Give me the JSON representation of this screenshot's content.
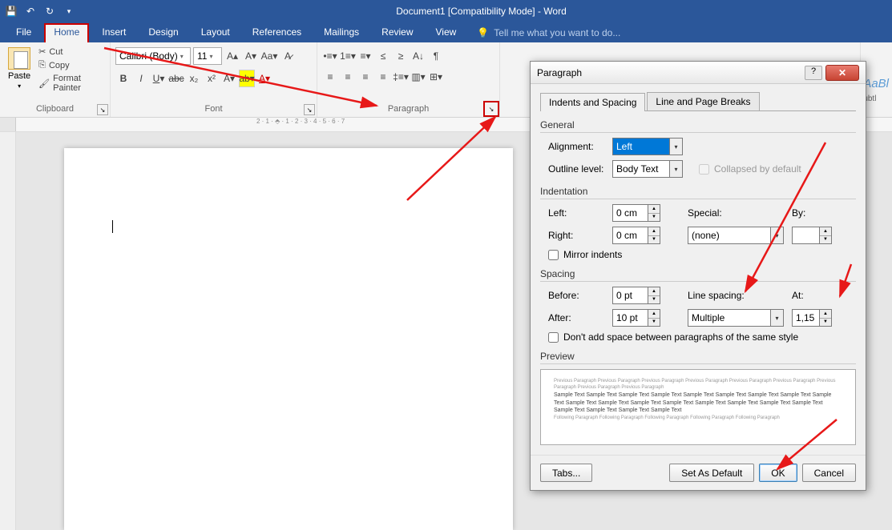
{
  "titlebar": {
    "title": "Document1 [Compatibility Mode] - Word"
  },
  "tabs": {
    "file": "File",
    "home": "Home",
    "insert": "Insert",
    "design": "Design",
    "layout": "Layout",
    "references": "References",
    "mailings": "Mailings",
    "review": "Review",
    "view": "View",
    "tellme": "Tell me what you want to do..."
  },
  "clipboard": {
    "paste": "Paste",
    "cut": "Cut",
    "copy": "Copy",
    "formatpainter": "Format Painter",
    "label": "Clipboard"
  },
  "font": {
    "name": "Calibri (Body)",
    "size": "11",
    "label": "Font"
  },
  "paragraph": {
    "label": "Paragraph"
  },
  "styles": {
    "subtle": "ubtl"
  },
  "dialog": {
    "title": "Paragraph",
    "tabs": {
      "indent": "Indents and Spacing",
      "breaks": "Line and Page Breaks"
    },
    "general": {
      "head": "General",
      "alignment_lbl": "Alignment:",
      "alignment_val": "Left",
      "outline_lbl": "Outline level:",
      "outline_val": "Body Text",
      "collapsed": "Collapsed by default"
    },
    "indent": {
      "head": "Indentation",
      "left_lbl": "Left:",
      "left_val": "0 cm",
      "right_lbl": "Right:",
      "right_val": "0 cm",
      "special_lbl": "Special:",
      "special_val": "(none)",
      "by_lbl": "By:",
      "mirror": "Mirror indents"
    },
    "spacing": {
      "head": "Spacing",
      "before_lbl": "Before:",
      "before_val": "0 pt",
      "after_lbl": "After:",
      "after_val": "10 pt",
      "line_lbl": "Line spacing:",
      "line_val": "Multiple",
      "at_lbl": "At:",
      "at_val": "1,15",
      "dontadd": "Don't add space between paragraphs of the same style"
    },
    "preview": {
      "head": "Preview",
      "prev": "Previous Paragraph Previous Paragraph Previous Paragraph Previous Paragraph Previous Paragraph Previous Paragraph Previous Paragraph Previous Paragraph Previous Paragraph",
      "sample": "Sample Text Sample Text Sample Text Sample Text Sample Text Sample Text Sample Text Sample Text Sample Text Sample Text Sample Text Sample Text Sample Text Sample Text Sample Text Sample Text Sample Text Sample Text Sample Text Sample Text Sample Text",
      "next": "Following Paragraph Following Paragraph Following Paragraph Following Paragraph Following Paragraph"
    },
    "buttons": {
      "tabs": "Tabs...",
      "default": "Set As Default",
      "ok": "OK",
      "cancel": "Cancel"
    }
  }
}
